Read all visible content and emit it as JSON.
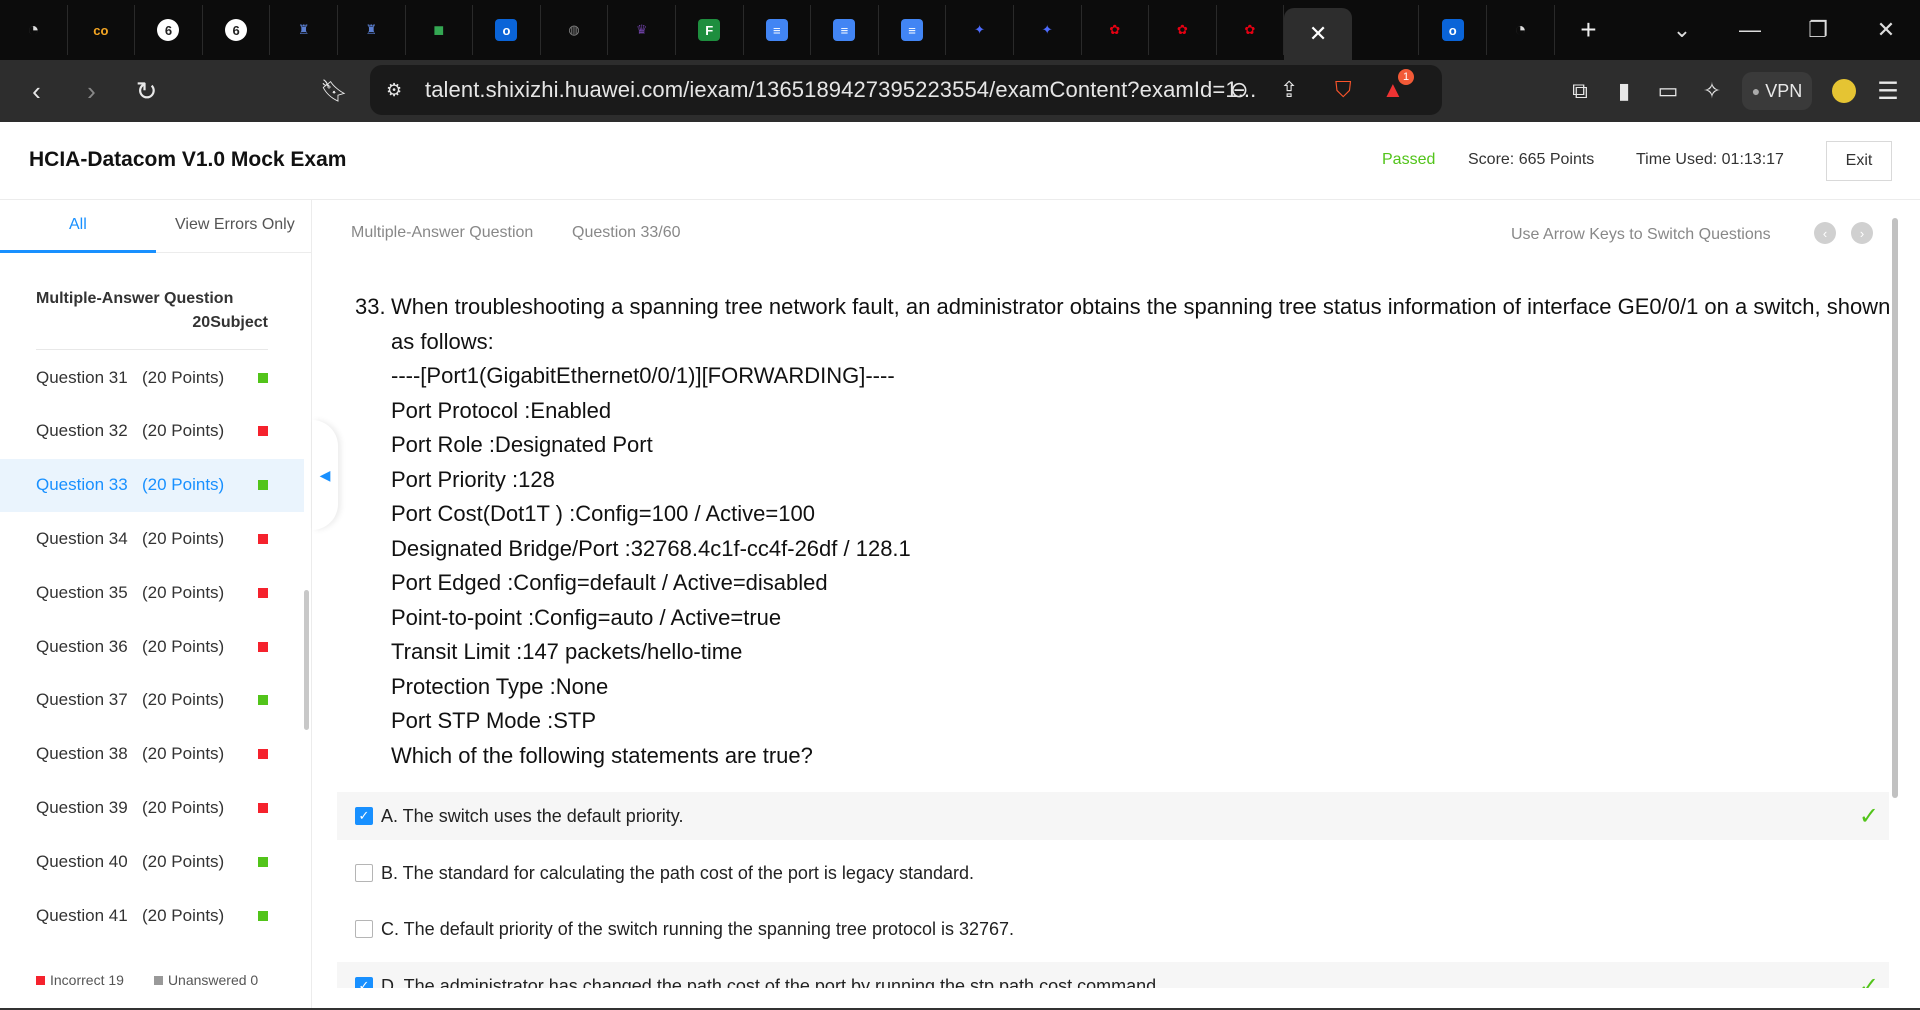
{
  "browser": {
    "tabs": [
      {
        "icon": "speedometer-icon",
        "color": "#333",
        "glyph": "◔"
      },
      {
        "icon": "co-logo-icon",
        "color": "#f5a623",
        "glyph": "co"
      },
      {
        "icon": "six-logo-icon",
        "color": "#ffffff",
        "glyph": "6"
      },
      {
        "icon": "six-logo-icon",
        "color": "#ffffff",
        "glyph": "6"
      },
      {
        "icon": "crest-icon",
        "color": "#5b7fd1",
        "glyph": "♜"
      },
      {
        "icon": "crest-icon",
        "color": "#5b7fd1",
        "glyph": "♜"
      },
      {
        "icon": "meet-icon",
        "color": "#34a853",
        "glyph": "■"
      },
      {
        "icon": "outlook-icon",
        "color": "#0a64d8",
        "glyph": "o"
      },
      {
        "icon": "globe-icon",
        "color": "#888888",
        "glyph": "◍"
      },
      {
        "icon": "castle-icon",
        "color": "#6b3fa0",
        "glyph": "♛"
      },
      {
        "icon": "forms-icon",
        "color": "#1e8e3e",
        "glyph": "F"
      },
      {
        "icon": "docs-icon",
        "color": "#4285f4",
        "glyph": "≡"
      },
      {
        "icon": "docs-icon",
        "color": "#4285f4",
        "glyph": "≡"
      },
      {
        "icon": "docs-icon",
        "color": "#4285f4",
        "glyph": "≡"
      },
      {
        "icon": "deepseek-icon",
        "color": "#4d6bfe",
        "glyph": "✦"
      },
      {
        "icon": "deepseek-icon",
        "color": "#4d6bfe",
        "glyph": "✦"
      },
      {
        "icon": "huawei-icon",
        "color": "#e60012",
        "glyph": "✿"
      },
      {
        "icon": "huawei-icon",
        "color": "#e60012",
        "glyph": "✿"
      },
      {
        "icon": "huawei-icon",
        "color": "#e60012",
        "glyph": "✿"
      }
    ],
    "url": "talent.shixizhi.huawei.com/iexam/1365189427395223554/examContent?examId=1...",
    "notification_count": "1",
    "vpn_label": "VPN"
  },
  "header": {
    "title": "HCIA-Datacom V1.0 Mock Exam",
    "status": "Passed",
    "score": "Score:  665 Points",
    "time_used": "Time Used:  01:13:17",
    "exit_label": "Exit",
    "status_color": "#52c41a"
  },
  "sidebar": {
    "tab_all": "All",
    "tab_errors": "View Errors Only",
    "section_title": "Multiple-Answer Question",
    "section_sub": "20Subject",
    "questions": [
      {
        "label": "Question 31",
        "points": "(20 Points)",
        "status": "correct"
      },
      {
        "label": "Question 32",
        "points": "(20 Points)",
        "status": "incorrect"
      },
      {
        "label": "Question 33",
        "points": "(20 Points)",
        "status": "correct",
        "active": true
      },
      {
        "label": "Question 34",
        "points": "(20 Points)",
        "status": "incorrect"
      },
      {
        "label": "Question 35",
        "points": "(20 Points)",
        "status": "incorrect"
      },
      {
        "label": "Question 36",
        "points": "(20 Points)",
        "status": "incorrect"
      },
      {
        "label": "Question 37",
        "points": "(20 Points)",
        "status": "correct"
      },
      {
        "label": "Question 38",
        "points": "(20 Points)",
        "status": "incorrect"
      },
      {
        "label": "Question 39",
        "points": "(20 Points)",
        "status": "incorrect"
      },
      {
        "label": "Question 40",
        "points": "(20 Points)",
        "status": "correct"
      },
      {
        "label": "Question 41",
        "points": "(20 Points)",
        "status": "correct"
      }
    ],
    "legend_incorrect": "Incorrect 19",
    "legend_unanswered": "Unanswered 0"
  },
  "main": {
    "question_type": "Multiple-Answer Question",
    "question_counter": "Question 33/60",
    "nav_hint": "Use Arrow Keys to Switch Questions",
    "question_number": "33.",
    "question_first": "When troubleshooting a spanning tree network fault, an administrator obtains the spanning tree status information of interface GE0/0/1 on a switch, shown",
    "question_lines": [
      "as follows:",
      "----[Port1(GigabitEthernet0/0/1)][FORWARDING]----",
      "Port Protocol :Enabled",
      "Port Role :Designated Port",
      "Port Priority :128",
      "Port Cost(Dot1T ) :Config=100 / Active=100",
      "Designated Bridge/Port :32768.4c1f-cc4f-26df / 128.1",
      "Port Edged :Config=default / Active=disabled",
      "Point-to-point :Config=auto / Active=true",
      "Transit Limit :147 packets/hello-time",
      "Protection Type :None",
      "Port STP Mode :STP",
      "Which of the following statements are true?"
    ],
    "options": [
      {
        "text": "A. The switch uses the default priority.",
        "checked": true,
        "correct": true
      },
      {
        "text": "B. The standard for calculating the path cost of the port is legacy standard.",
        "checked": false,
        "correct": false
      },
      {
        "text": "C. The default priority of the switch running the spanning tree protocol is 32767.",
        "checked": false,
        "correct": false
      },
      {
        "text": "D. The administrator has changed the path cost of the port by running the stp path cost command.",
        "checked": true,
        "correct": true
      }
    ]
  },
  "colors": {
    "accent": "#1890ff",
    "correct": "#52c41a",
    "incorrect": "#f5222d",
    "unanswered": "#999999"
  }
}
